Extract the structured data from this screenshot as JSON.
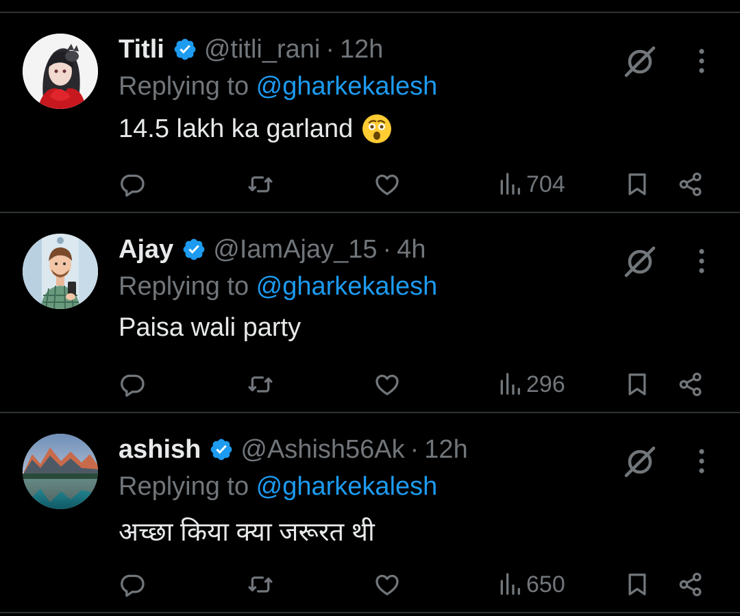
{
  "colors": {
    "background": "#000000",
    "text": "#e7e9ea",
    "muted": "#71767b",
    "accent": "#1d9bf0",
    "separator": "#2f3336"
  },
  "icons": {
    "verified": "verified-badge-icon",
    "grok": "grok-icon",
    "more": "more-options-icon",
    "reply": "reply-icon",
    "repost": "repost-icon",
    "like": "like-icon",
    "views": "views-icon",
    "bookmark": "bookmark-icon",
    "share": "share-icon"
  },
  "tweets": [
    {
      "name": "Titli",
      "handle": "@titli_rani",
      "sep": "·",
      "time": "12h",
      "reply_prefix": "Replying to ",
      "reply_to": "@gharkekalesh",
      "text": "14.5 lakh ka garland",
      "emoji": "astonished-face-emoji",
      "views": "704"
    },
    {
      "name": "Ajay",
      "handle": "@IamAjay_15",
      "sep": "·",
      "time": "4h",
      "reply_prefix": "Replying to ",
      "reply_to": "@gharkekalesh",
      "text": "Paisa wali party",
      "views": "296"
    },
    {
      "name": "ashish",
      "handle": "@Ashish56Ak",
      "sep": "·",
      "time": "12h",
      "reply_prefix": "Replying to ",
      "reply_to": "@gharkekalesh",
      "text": "अच्छा किया क्या जरूरत थी",
      "views": "650"
    }
  ]
}
